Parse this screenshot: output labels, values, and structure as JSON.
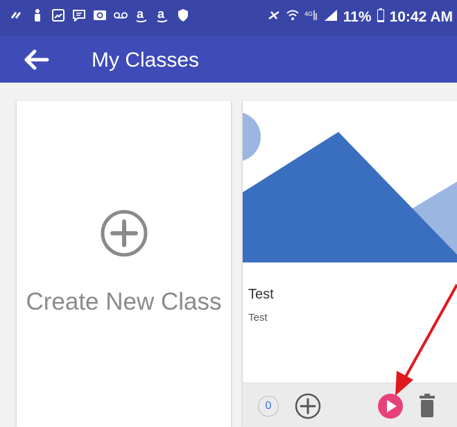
{
  "status_bar": {
    "battery": "11%",
    "time": "10:42 AM",
    "left_icons": [
      "link-icon",
      "person-icon",
      "image-icon",
      "message-icon",
      "email-icon",
      "voicemail-icon",
      "amazon-icon",
      "amazon-icon",
      "shield-icon"
    ],
    "right_icons": [
      "mute-icon",
      "wifi-icon",
      "lte-icon",
      "signal-icon",
      "battery-icon"
    ]
  },
  "app_bar": {
    "title": "My Classes",
    "back_icon": "arrow-left-icon"
  },
  "create_card": {
    "label": "Create New Class",
    "icon": "add-circle-icon"
  },
  "class_card": {
    "title": "Test",
    "subtitle": "Test",
    "student_count": "0",
    "footer_icons": [
      "add-circle-icon",
      "play-icon",
      "trash-icon"
    ]
  },
  "colors": {
    "status_bar": "#3a45a8",
    "app_bar": "#3f4bb6",
    "play_accent": "#e8417a",
    "banner_dark": "#3a6fc0",
    "banner_light": "#9bb6e0",
    "annotation_arrow": "#e0191f"
  }
}
